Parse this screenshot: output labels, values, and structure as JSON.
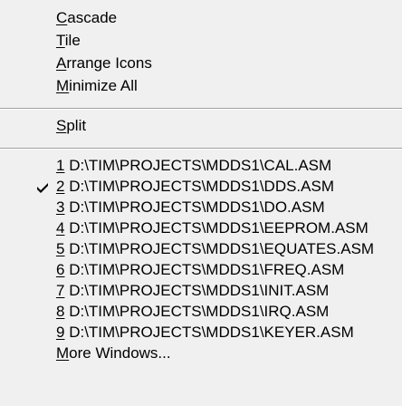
{
  "menu": {
    "arrange": [
      {
        "mnemonic": "C",
        "rest": "ascade"
      },
      {
        "mnemonic": "T",
        "rest": "ile"
      },
      {
        "mnemonic": "A",
        "rest": "rrange Icons"
      },
      {
        "mnemonic": "M",
        "rest": "inimize All"
      }
    ],
    "split": {
      "mnemonic": "S",
      "rest": "plit"
    },
    "windows": [
      {
        "mnemonic": "1",
        "rest": " D:\\TIM\\PROJECTS\\MDDS1\\CAL.ASM",
        "checked": false
      },
      {
        "mnemonic": "2",
        "rest": " D:\\TIM\\PROJECTS\\MDDS1\\DDS.ASM",
        "checked": true
      },
      {
        "mnemonic": "3",
        "rest": " D:\\TIM\\PROJECTS\\MDDS1\\DO.ASM",
        "checked": false
      },
      {
        "mnemonic": "4",
        "rest": " D:\\TIM\\PROJECTS\\MDDS1\\EEPROM.ASM",
        "checked": false
      },
      {
        "mnemonic": "5",
        "rest": " D:\\TIM\\PROJECTS\\MDDS1\\EQUATES.ASM",
        "checked": false
      },
      {
        "mnemonic": "6",
        "rest": " D:\\TIM\\PROJECTS\\MDDS1\\FREQ.ASM",
        "checked": false
      },
      {
        "mnemonic": "7",
        "rest": " D:\\TIM\\PROJECTS\\MDDS1\\INIT.ASM",
        "checked": false
      },
      {
        "mnemonic": "8",
        "rest": " D:\\TIM\\PROJECTS\\MDDS1\\IRQ.ASM",
        "checked": false
      },
      {
        "mnemonic": "9",
        "rest": " D:\\TIM\\PROJECTS\\MDDS1\\KEYER.ASM",
        "checked": false
      }
    ],
    "more": {
      "mnemonic": "M",
      "rest": "ore Windows..."
    },
    "check_icon": "checkmark-icon"
  }
}
